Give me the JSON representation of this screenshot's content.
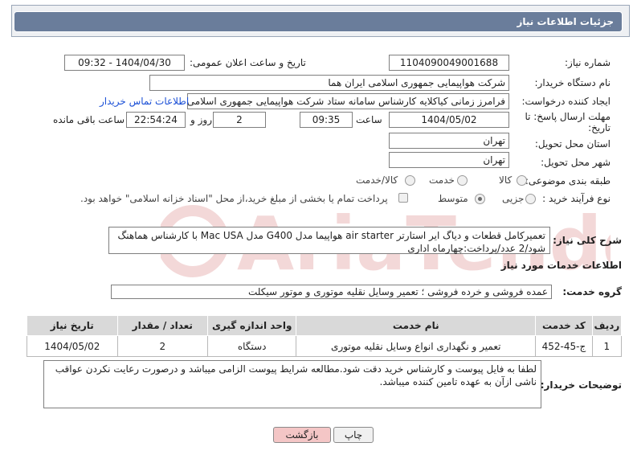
{
  "header": {
    "title": "جزئیات اطلاعات نیاز"
  },
  "form": {
    "need_number_label": "شماره نیاز:",
    "need_number": "1104090049001688",
    "announce_label": "تاریخ و ساعت اعلان عمومی:",
    "announce_value": "1404/04/30 - 09:32",
    "buyer_label": "نام دستگاه خریدار:",
    "buyer_value": "شرکت هواپیمایی جمهوری اسلامی ایران هما",
    "creator_label": "ایجاد کننده درخواست:",
    "creator_value": "فرامرز زمانی کیاکلایه کارشناس سامانه ستاد شرکت هواپیمایی جمهوری اسلامی ایران هما",
    "contact_link": "اطلاعات تماس خریدار",
    "deadline_label_1": "مهلت ارسال پاسخ: تا",
    "deadline_label_2": "تاریخ:",
    "deadline_date": "1404/05/02",
    "time_label": "ساعت",
    "deadline_time": "09:35",
    "days_value": "2",
    "days_label": "روز و",
    "remaining_value": "22:54:24",
    "remaining_label": "ساعت باقی مانده",
    "province_label": "استان محل تحویل:",
    "province_value": "تهران",
    "city_label": "شهر محل تحویل:",
    "city_value": "تهران",
    "category_label": "طبقه بندی موضوعی:",
    "category_options": [
      "کالا",
      "خدمت",
      "کالا/خدمت"
    ],
    "process_label": "نوع فرآیند خرید :",
    "process_options": [
      "جزیی",
      "متوسط"
    ],
    "payment_note": "پرداخت تمام یا بخشی از مبلغ خرید،از محل \"اسناد خزانه اسلامی\" خواهد بود."
  },
  "summary": {
    "label": "شرح کلی نیاز:",
    "text": "تعمیرکامل قطعات و دیاگ ایر استارتر air starter هواپیما مدل G400 مدل Mac USA با کارشناس هماهنگ شود/2 عدد/پرداخت:چهارماه اداری"
  },
  "services": {
    "section_title": "اطلاعات خدمات مورد نیاز",
    "group_label": "گروه خدمت:",
    "group_value": "عمده فروشی و خرده فروشی ؛ تعمیر وسایل نقلیه موتوری و موتور سیکلت",
    "columns": [
      "ردیف",
      "کد خدمت",
      "نام خدمت",
      "واحد اندازه گیری",
      "تعداد / مقدار",
      "تاریخ نیاز"
    ],
    "rows": [
      [
        "1",
        "ج-45-452",
        "تعمیر و نگهداری انواع وسایل نقلیه موتوری",
        "دستگاه",
        "2",
        "1404/05/02"
      ]
    ]
  },
  "buyer_notes": {
    "label": "توضیحات خریدار:",
    "text": "لطفا به فایل پیوست و کارشناس خرید دقت شود.مطالعه شرایط پیوست الزامی میباشد و درصورت رعایت نکردن عواقب ناشی ازآن به عهده تامین کننده میباشد."
  },
  "buttons": {
    "print": "چاپ",
    "back": "بازگشت"
  },
  "watermark": {
    "text": "AriaTender.neT"
  },
  "colors": {
    "header_bar": "#6a7d9b",
    "link": "#1a4fd6",
    "back_button": "#f4c6c6"
  }
}
